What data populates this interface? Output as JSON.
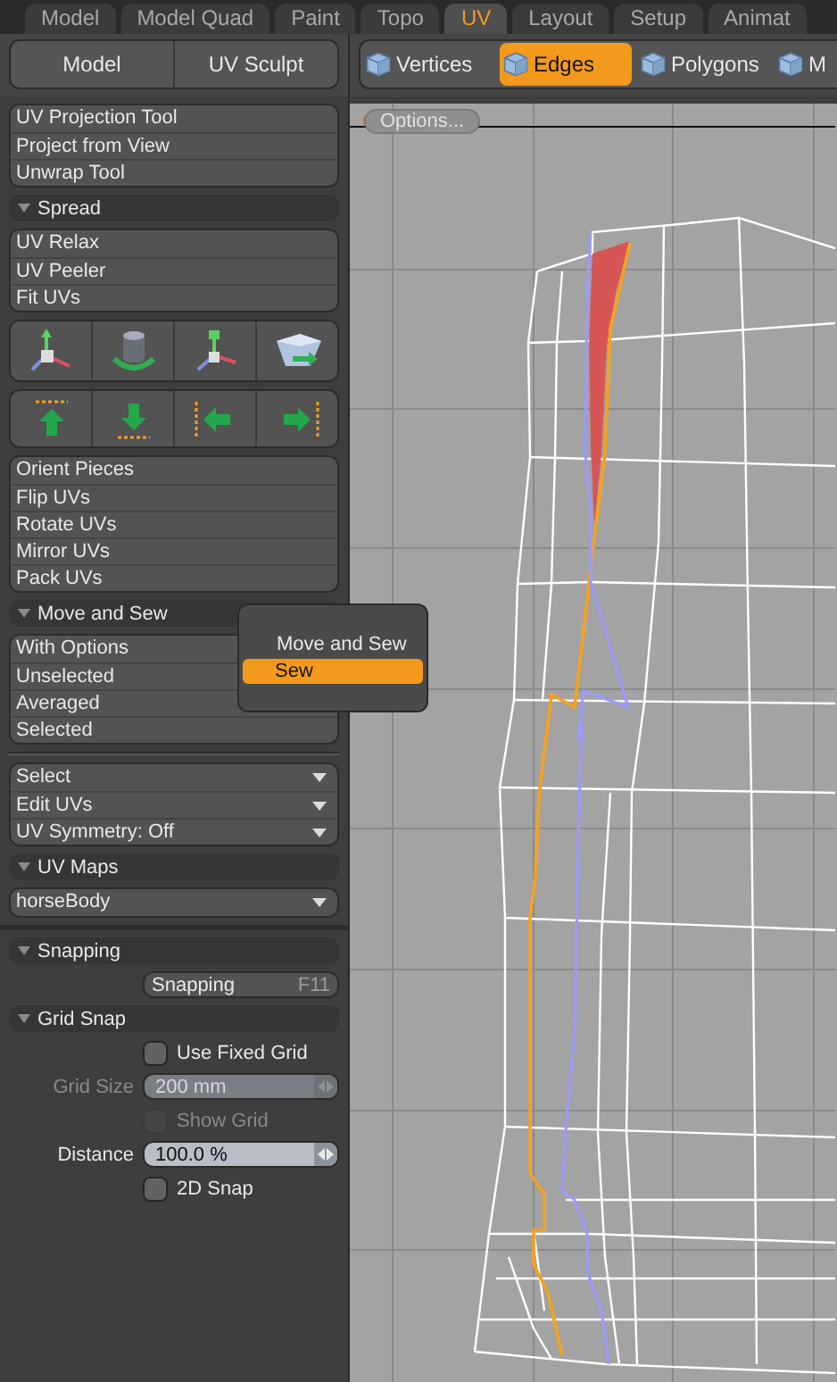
{
  "tabs": [
    {
      "label": "Model",
      "selected": false
    },
    {
      "label": "Model Quad",
      "selected": false
    },
    {
      "label": "Paint",
      "selected": false
    },
    {
      "label": "Topo",
      "selected": false
    },
    {
      "label": "UV",
      "selected": true
    },
    {
      "label": "Layout",
      "selected": false
    },
    {
      "label": "Setup",
      "selected": false
    },
    {
      "label": "Animat",
      "selected": false
    }
  ],
  "mode_buttons": [
    "Model",
    "UV Sculpt"
  ],
  "selection_modes": [
    {
      "label": "Vertices",
      "selected": false
    },
    {
      "label": "Edges",
      "selected": true
    },
    {
      "label": "Polygons",
      "selected": false
    },
    {
      "label": "M",
      "selected": false
    }
  ],
  "panel": [
    {
      "kind": "button_group",
      "items": [
        "UV Projection Tool",
        "Project from View",
        "Unwrap Tool"
      ]
    },
    {
      "kind": "header",
      "label": "Spread",
      "expanded": true
    },
    {
      "kind": "button_group",
      "items": [
        "UV Relax",
        "UV Peeler",
        "Fit UVs"
      ]
    },
    {
      "kind": "transform_icons"
    },
    {
      "kind": "align_icons"
    },
    {
      "kind": "button_group",
      "items": [
        "Orient Pieces",
        "Flip UVs",
        "Rotate UVs",
        "Mirror UVs",
        "Pack UVs"
      ]
    },
    {
      "kind": "header",
      "label": "Move and Sew",
      "expanded": true
    },
    {
      "kind": "button_group",
      "items": [
        "With Options",
        "Unselected",
        "Averaged",
        "Selected"
      ]
    },
    {
      "kind": "divider"
    },
    {
      "kind": "dropdown_group",
      "items": [
        "Select",
        "Edit UVs",
        "UV Symmetry: Off"
      ]
    },
    {
      "kind": "header",
      "label": "UV Maps",
      "expanded": true
    },
    {
      "kind": "dropdown_group",
      "items": [
        "horseBody"
      ]
    },
    {
      "kind": "separator"
    },
    {
      "kind": "header",
      "label": "Snapping",
      "expanded": true
    },
    {
      "kind": "shortcut_button",
      "label": "Snapping",
      "shortcut": "F11"
    },
    {
      "kind": "header",
      "label": "Grid Snap",
      "expanded": true
    },
    {
      "kind": "checkbox",
      "label": "Use Fixed Grid",
      "checked": false,
      "disabled": false
    },
    {
      "kind": "field",
      "label": "Grid Size",
      "value": "200 mm",
      "disabled": true
    },
    {
      "kind": "checkbox",
      "label": "Show Grid",
      "checked": false,
      "disabled": true
    },
    {
      "kind": "field",
      "label": "Distance",
      "value": "100.0 %",
      "disabled": false
    },
    {
      "kind": "checkbox",
      "label": "2D Snap",
      "checked": false,
      "disabled": false
    }
  ],
  "popup": {
    "items": [
      {
        "label": "Move and Sew",
        "selected": false
      },
      {
        "label": "Sew",
        "selected": true
      }
    ]
  },
  "viewport": {
    "options_button": "Options..."
  }
}
